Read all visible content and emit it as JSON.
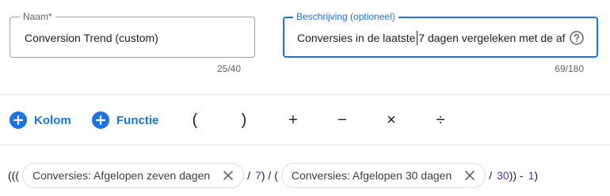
{
  "name_field": {
    "label": "Naam*",
    "value": "Conversion Trend (custom)",
    "counter": "25/40"
  },
  "description_field": {
    "label": "Beschrijving (optioneel)",
    "value": "Conversies in de laatste 7 dagen vergeleken met de af",
    "counter": "69/180",
    "help_icon": "help-circle-icon"
  },
  "toolbar": {
    "column_label": "Kolom",
    "function_label": "Functie",
    "open_paren": "(",
    "close_paren": ")",
    "plus": "+",
    "minus": "−",
    "times": "×",
    "divide": "÷",
    "accent_color": "#1a73e8"
  },
  "formula": {
    "prefix": "(((",
    "chip1": "Conversies: Afgelopen zeven dagen",
    "slash1": "/",
    "num1": "7",
    "mid": ") / (",
    "chip2": "Conversies: Afgelopen 30 dagen",
    "slash2": "/",
    "num2": "30",
    "after2": ")) -",
    "num3": "1",
    "end": ")"
  }
}
